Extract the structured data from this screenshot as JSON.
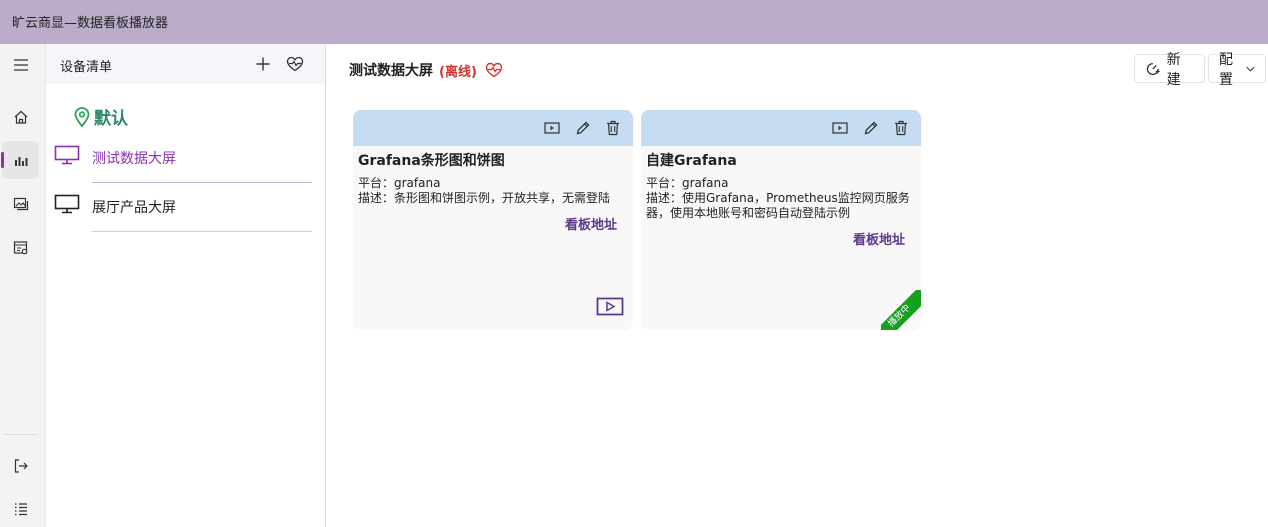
{
  "window": {
    "title": "旷云商显—数据看板播放器"
  },
  "device_panel": {
    "header": "设备清单",
    "group": "默认",
    "devices": [
      {
        "name": "测试数据大屏",
        "active": true
      },
      {
        "name": "展厅产品大屏",
        "active": false
      }
    ]
  },
  "main": {
    "device_title": "测试数据大屏",
    "status": "(离线)",
    "new_label": "新建",
    "config_label": "配置",
    "cards": [
      {
        "title": "Grafana条形图和饼图",
        "platform": "平台：grafana",
        "description": "描述：条形图和饼图示例，开放共享，无需登陆",
        "link": "看板地址",
        "playing": false
      },
      {
        "title": "自建Grafana",
        "platform": "平台：grafana",
        "description": "描述：使用Grafana，Prometheus监控网页服务器，使用本地账号和密码自动登陆示例",
        "link": "看板地址",
        "playing": true,
        "badge": "播放中"
      }
    ]
  },
  "colors": {
    "titlebar": "#bbadc9",
    "accent": "#7a3e98",
    "group_pin": "#2aa05a",
    "offline": "#d8332a",
    "card_header": "#c5dcf2",
    "playing_badge": "#15a020"
  }
}
